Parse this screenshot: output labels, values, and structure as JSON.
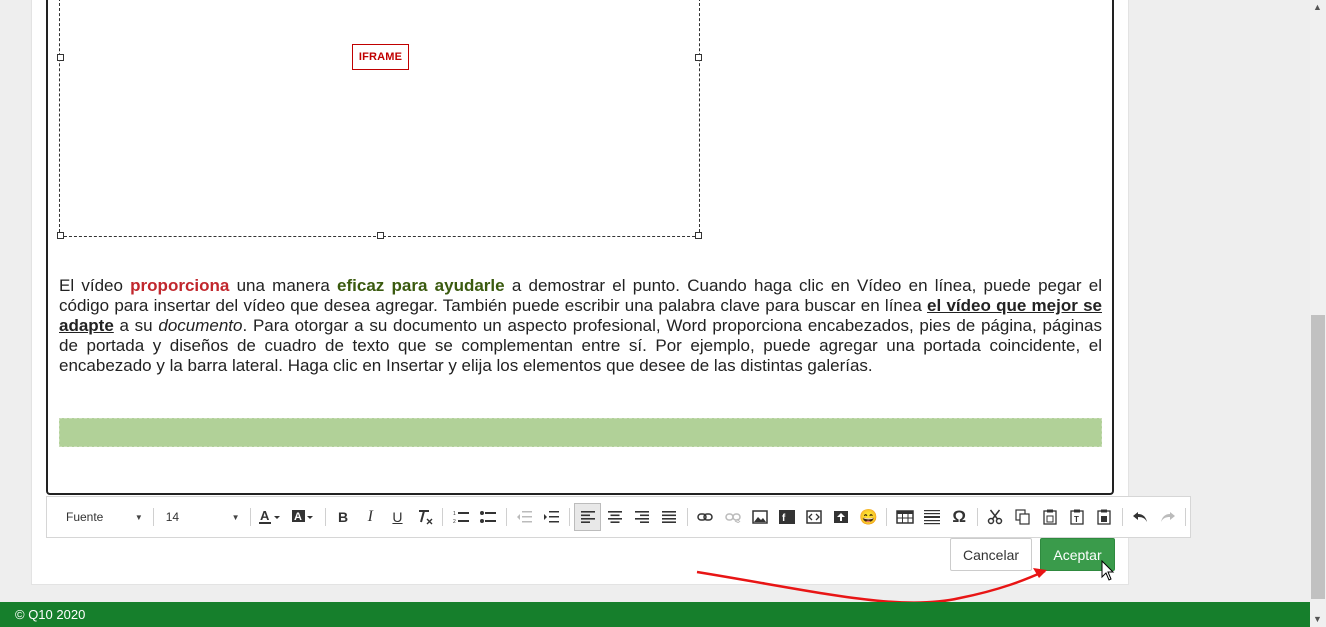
{
  "editor": {
    "iframe_label": "IFRAME",
    "paragraph": {
      "t1": "El vídeo ",
      "t2": "proporciona",
      "t3": " una manera ",
      "t4": "eficaz para ayudarle",
      "t5": " a demostrar el punto. Cuando haga clic en Vídeo en línea, puede pegar el código para insertar del vídeo que desea agregar. También puede escribir una palabra clave para buscar en línea ",
      "t6": "el vídeo que mejor se adapte",
      "t7": " a su ",
      "t8": "documento",
      "t9": ". Para otorgar a su documento un aspecto profesional, Word proporciona encabezados, pies de página, páginas de portada y diseños de cuadro de texto que se complementan entre sí. Por ejemplo, puede agregar una portada coincidente, el encabezado y la barra lateral. Haga clic en Insertar y elija los elementos que desee de las distintas galerías."
    },
    "colors": {
      "highlight_red": "#c1272d",
      "highlight_green": "#3a5a0f",
      "band": "#b1d198"
    }
  },
  "toolbar": {
    "font_label": "Fuente",
    "size_label": "14",
    "icons": [
      "text-color-icon",
      "background-color-icon",
      "bold-icon",
      "italic-icon",
      "underline-icon",
      "remove-format-icon",
      "numbered-list-icon",
      "bulleted-list-icon",
      "decrease-indent-icon",
      "increase-indent-icon",
      "align-left-icon",
      "align-center-icon",
      "align-right-icon",
      "justify-icon",
      "link-icon",
      "unlink-icon",
      "image-icon",
      "flash-icon",
      "iframe-icon",
      "upload-icon",
      "emoji-icon",
      "table-icon",
      "horizontal-line-icon",
      "special-char-icon",
      "cut-icon",
      "copy-icon",
      "paste-icon",
      "paste-text-icon",
      "paste-word-icon",
      "undo-icon",
      "redo-icon"
    ],
    "italic_glyph": "I",
    "underline_glyph": "U",
    "bold_glyph": "B",
    "omega_glyph": "Ω",
    "emoji_glyph": "😄"
  },
  "actions": {
    "cancel_label": "Cancelar",
    "accept_label": "Aceptar",
    "accept_color": "#3a9b4b"
  },
  "footer": {
    "copyright": "© Q10 2020",
    "color": "#167f2c"
  }
}
